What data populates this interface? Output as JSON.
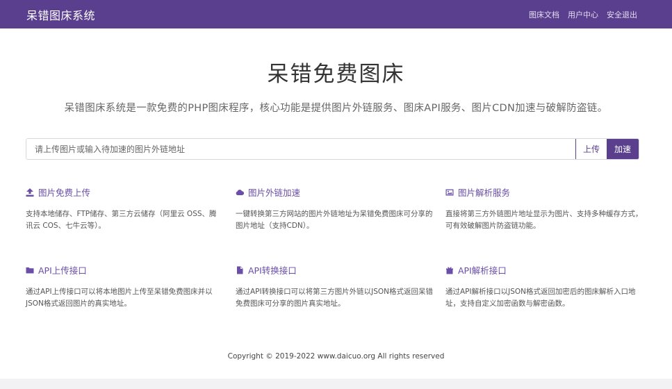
{
  "navbar": {
    "brand": "呆错图床系统",
    "links": [
      "图床文档",
      "用户中心",
      "安全退出"
    ]
  },
  "hero": {
    "title": "呆错免费图床",
    "subtitle": "呆错图床系统是一款免费的PHP图床程序，核心功能是提供图片外链服务、图床API服务、图片CDN加速与破解防盗链。"
  },
  "search": {
    "placeholder": "请上传图片或输入待加速的图片外链地址",
    "value": "",
    "upload_label": "上传",
    "accelerate_label": "加速"
  },
  "features": [
    {
      "icon": "upload-icon",
      "title": "图片免费上传",
      "desc": "支持本地储存、FTP储存、第三方云储存（阿里云 OSS、腾讯云 COS、七牛云等）。"
    },
    {
      "icon": "cloud-icon",
      "title": "图片外链加速",
      "desc": "一键转换第三方网站的图片外链地址为呆错免费图床可分享的图片地址（支持CDN）。"
    },
    {
      "icon": "image-icon",
      "title": "图片解析服务",
      "desc": "直接将第三方外链图片地址显示为图片、支持多种缓存方式，可有效破解图片防盗链功能。"
    },
    {
      "icon": "folder-icon",
      "title": "API上传接口",
      "desc": "通过API上传接口可以将本地图片上传至呆错免费图床并以JSON格式返回图片的真实地址。"
    },
    {
      "icon": "file-icon",
      "title": "API转换接口",
      "desc": "通过API转换接口可以将第三方图片外链以JSON格式返回呆错免费图床可分享的图片真实地址。"
    },
    {
      "icon": "gift-icon",
      "title": "API解析接口",
      "desc": "通过API解析接口以JSON格式返回加密后的图床解析入口地址，支持自定义加密函数与解密函数。"
    }
  ],
  "footer": "Copyright © 2019-2022 www.daicuo.org All rights reserved",
  "colors": {
    "accent": "#5b3f8f",
    "link": "#6a4ea8"
  }
}
